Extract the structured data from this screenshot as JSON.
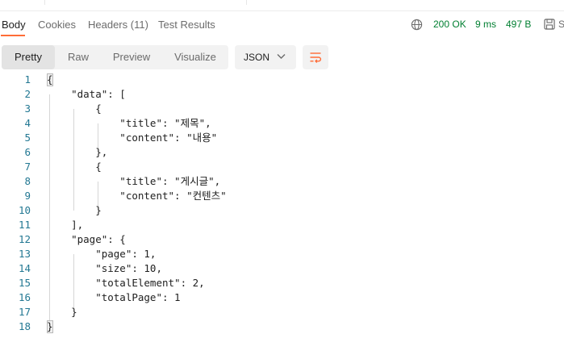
{
  "tabs": [
    {
      "label": "Body",
      "active": true
    },
    {
      "label": "Cookies",
      "active": false
    },
    {
      "label": "Headers (11)",
      "active": false
    },
    {
      "label": "Test Results",
      "active": false
    }
  ],
  "status": {
    "code": "200 OK",
    "time": "9 ms",
    "size": "497 B",
    "save_label": "S",
    "color": "#007f31"
  },
  "view_modes": [
    {
      "label": "Pretty",
      "active": true
    },
    {
      "label": "Raw",
      "active": false
    },
    {
      "label": "Preview",
      "active": false
    },
    {
      "label": "Visualize",
      "active": false
    }
  ],
  "format": {
    "selected": "JSON"
  },
  "icons": {
    "globe": "globe-icon",
    "save": "save-icon",
    "chevron": "chevron-down-icon",
    "wrap": "wrap-lines-icon"
  },
  "accent_color": "#ff6c37",
  "code_lines": [
    {
      "number": "1",
      "text": "{"
    },
    {
      "number": "2",
      "text": "    \"data\": ["
    },
    {
      "number": "3",
      "text": "        {"
    },
    {
      "number": "4",
      "text": "            \"title\": \"제목\","
    },
    {
      "number": "5",
      "text": "            \"content\": \"내용\""
    },
    {
      "number": "6",
      "text": "        },"
    },
    {
      "number": "7",
      "text": "        {"
    },
    {
      "number": "8",
      "text": "            \"title\": \"게시글\","
    },
    {
      "number": "9",
      "text": "            \"content\": \"컨텐츠\""
    },
    {
      "number": "10",
      "text": "        }"
    },
    {
      "number": "11",
      "text": "    ],"
    },
    {
      "number": "12",
      "text": "    \"page\": {"
    },
    {
      "number": "13",
      "text": "        \"page\": 1,"
    },
    {
      "number": "14",
      "text": "        \"size\": 10,"
    },
    {
      "number": "15",
      "text": "        \"totalElement\": 2,"
    },
    {
      "number": "16",
      "text": "        \"totalPage\": 1"
    },
    {
      "number": "17",
      "text": "    }"
    },
    {
      "number": "18",
      "text": "}"
    }
  ]
}
